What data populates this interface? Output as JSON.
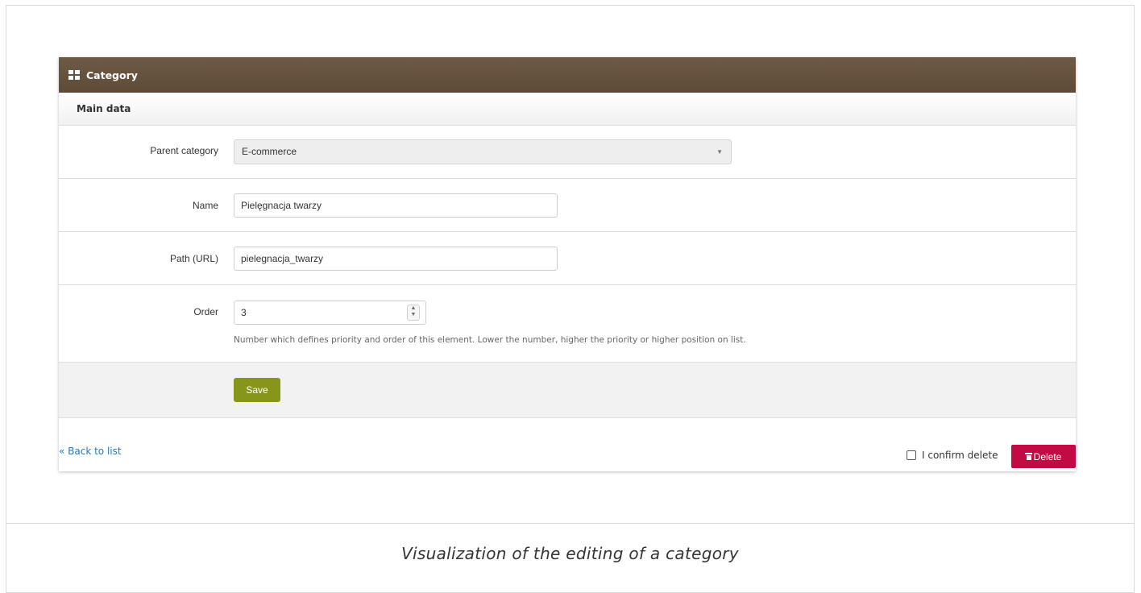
{
  "panel": {
    "title": "Category",
    "section_title": "Main data"
  },
  "form": {
    "parent_category": {
      "label": "Parent category",
      "value": "E-commerce"
    },
    "name": {
      "label": "Name",
      "value": "Pielęgnacja twarzy"
    },
    "path": {
      "label": "Path (URL)",
      "value": "pielegnacja_twarzy"
    },
    "order": {
      "label": "Order",
      "value": "3",
      "hint": "Number which defines priority and order of this element. Lower the number, higher the priority or higher position on list."
    },
    "save_label": "Save"
  },
  "footer": {
    "back_label": "« Back to list",
    "confirm_label": "I confirm delete",
    "delete_label": "Delete"
  },
  "caption": "Visualization of the editing of a category",
  "colors": {
    "header": "#6a5640",
    "save": "#88951b",
    "delete": "#c20a45",
    "link": "#1f7ac0"
  }
}
